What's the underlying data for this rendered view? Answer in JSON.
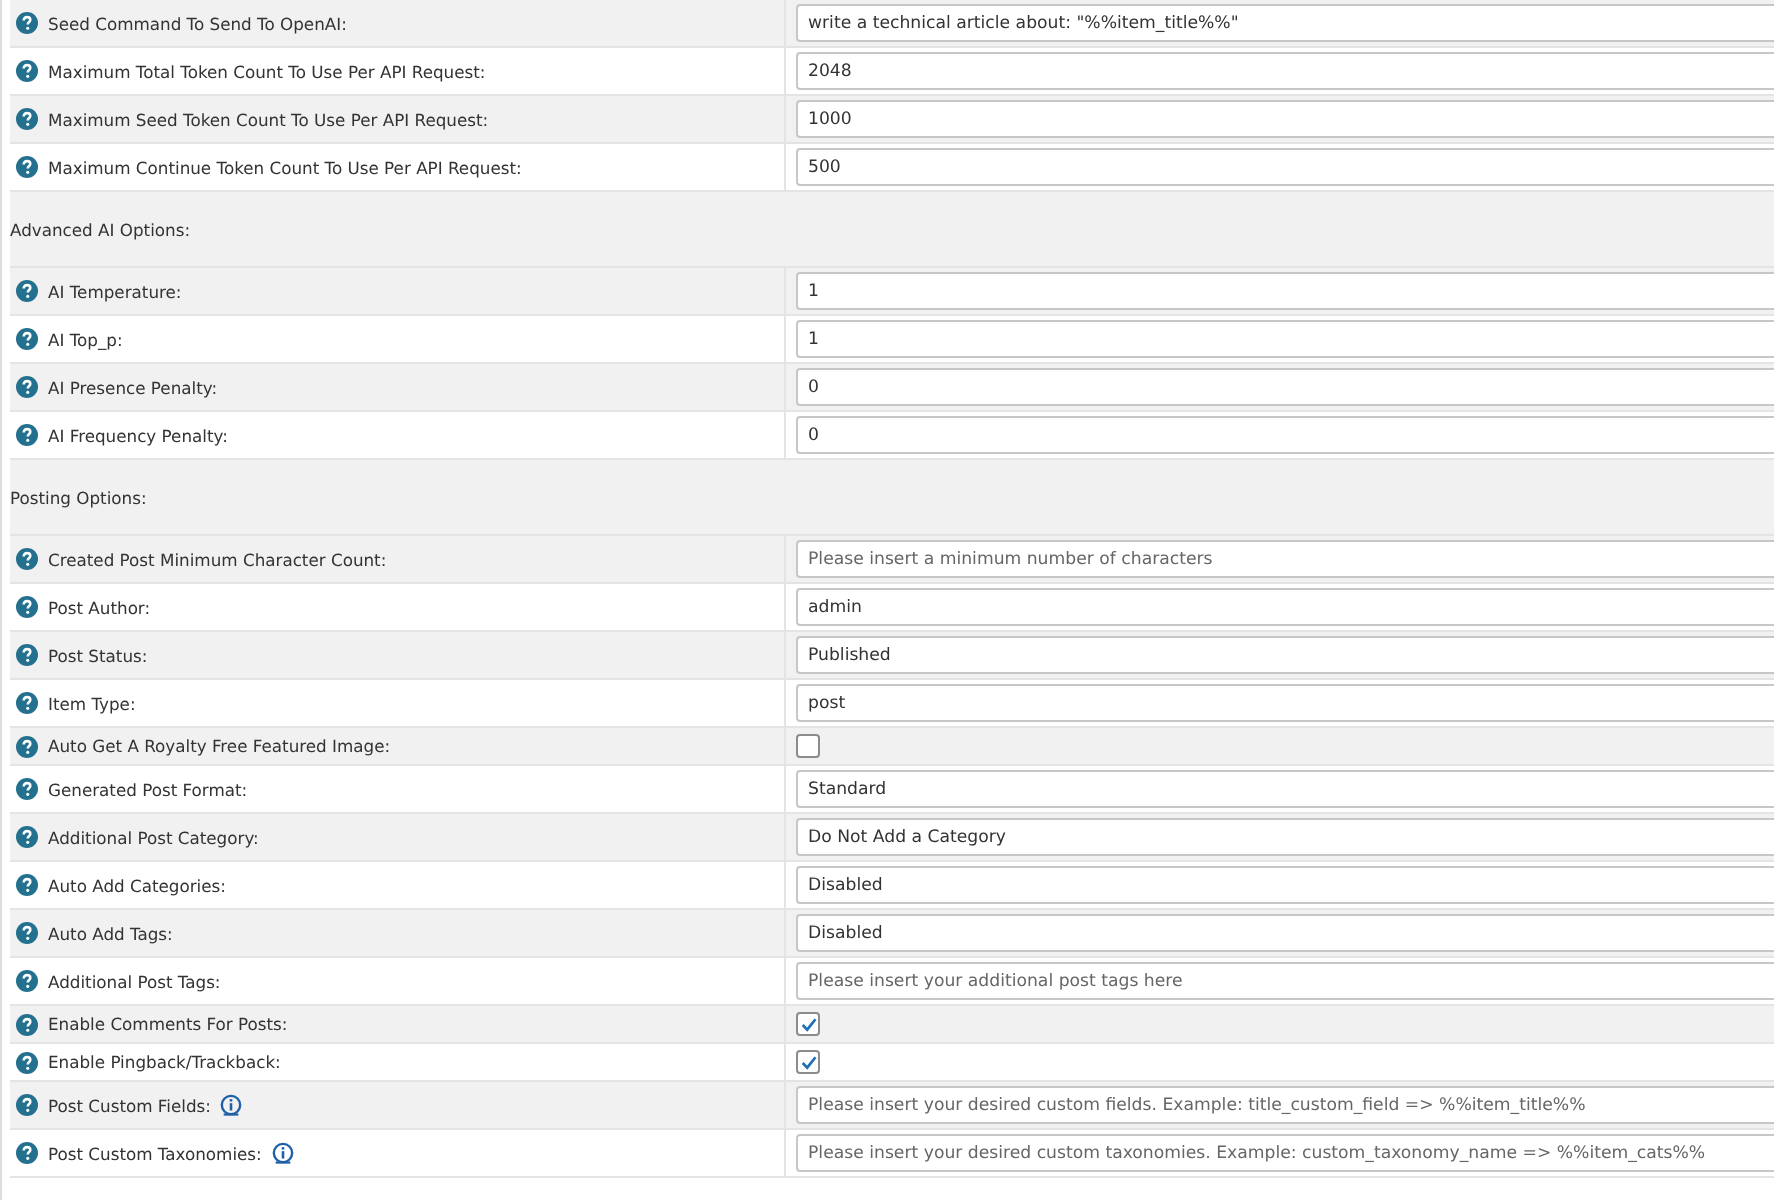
{
  "rows": [
    {
      "kind": "field",
      "label": "Seed Command To Send To OpenAI:",
      "value": "write a technical article about: \"%%item_title%%\""
    },
    {
      "kind": "field",
      "label": "Maximum Total Token Count To Use Per API Request:",
      "value": "2048"
    },
    {
      "kind": "field",
      "label": "Maximum Seed Token Count To Use Per API Request:",
      "value": "1000"
    },
    {
      "kind": "field",
      "label": "Maximum Continue Token Count To Use Per API Request:",
      "value": "500"
    },
    {
      "kind": "section",
      "label": "Advanced AI Options:"
    },
    {
      "kind": "field",
      "label": "AI Temperature:",
      "value": "1"
    },
    {
      "kind": "field",
      "label": "AI Top_p:",
      "value": "1"
    },
    {
      "kind": "field",
      "label": "AI Presence Penalty:",
      "value": "0"
    },
    {
      "kind": "field",
      "label": "AI Frequency Penalty:",
      "value": "0"
    },
    {
      "kind": "section",
      "label": "Posting Options:"
    },
    {
      "kind": "field",
      "label": "Created Post Minimum Character Count:",
      "placeholder": "Please insert a minimum number of characters"
    },
    {
      "kind": "field",
      "label": "Post Author:",
      "value": "admin"
    },
    {
      "kind": "field",
      "label": "Post Status:",
      "value": "Published"
    },
    {
      "kind": "field",
      "label": "Item Type:",
      "value": "post"
    },
    {
      "kind": "checkbox",
      "label": "Auto Get A Royalty Free Featured Image:",
      "checked": false
    },
    {
      "kind": "field",
      "label": "Generated Post Format:",
      "value": "Standard"
    },
    {
      "kind": "field",
      "label": "Additional Post Category:",
      "value": "Do Not Add a Category"
    },
    {
      "kind": "field",
      "label": "Auto Add Categories:",
      "value": "Disabled"
    },
    {
      "kind": "field",
      "label": "Auto Add Tags:",
      "value": "Disabled"
    },
    {
      "kind": "field",
      "label": "Additional Post Tags:",
      "placeholder": "Please insert your additional post tags here"
    },
    {
      "kind": "checkbox",
      "label": "Enable Comments For Posts:",
      "checked": true
    },
    {
      "kind": "checkbox",
      "label": "Enable Pingback/Trackback:",
      "checked": true
    },
    {
      "kind": "field",
      "label": "Post Custom Fields:",
      "info": true,
      "placeholder": "Please insert your desired custom fields. Example: title_custom_field => %%item_title%%"
    },
    {
      "kind": "field",
      "label": "Post Custom Taxonomies:",
      "info": true,
      "placeholder": "Please insert your desired custom taxonomies. Example: custom_taxonomy_name => %%item_cats%%"
    }
  ]
}
